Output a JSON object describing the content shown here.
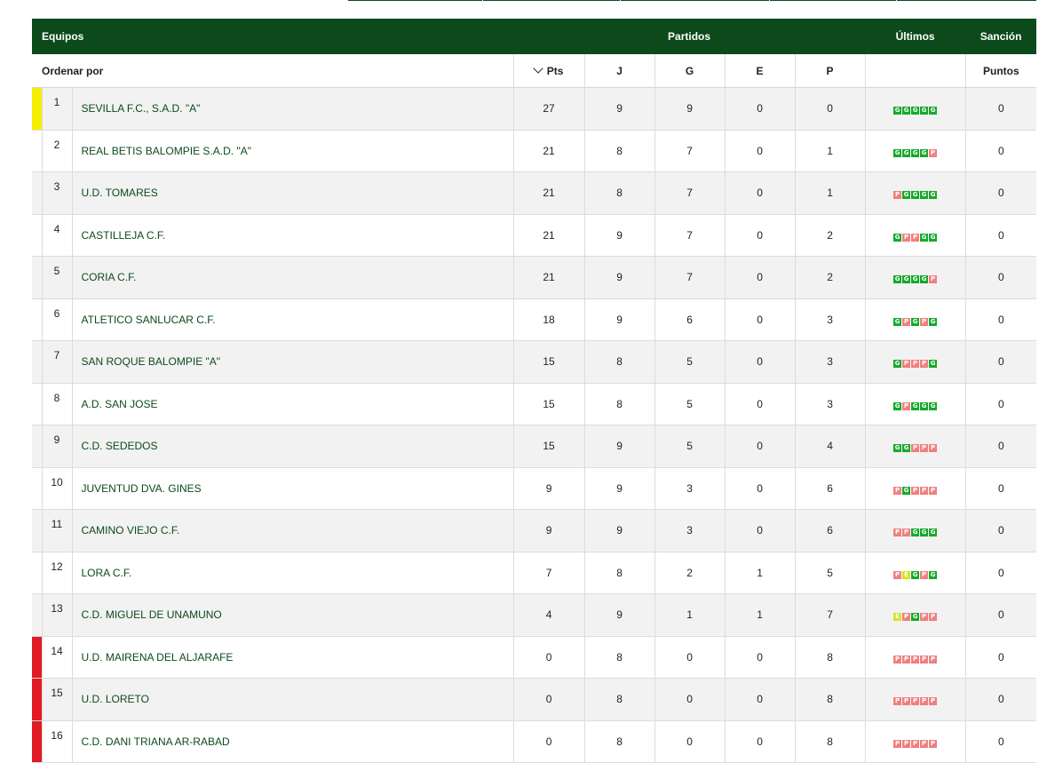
{
  "colors": {
    "header_bg": "#0c4a1c",
    "team_text": "#0c4a1c",
    "promotion": "#f4ee00",
    "relegation": "#e21a23",
    "win": "#16a92a",
    "loss": "#f08080",
    "draw": "#d7e21f"
  },
  "header": {
    "teams": "Equipos",
    "matches": "Partidos",
    "last": "Últimos",
    "sanction": "Sanción"
  },
  "subheader": {
    "sort_by": "Ordenar por",
    "pts": "Pts",
    "j": "J",
    "g": "G",
    "e": "E",
    "p": "P",
    "points": "Puntos"
  },
  "rows": [
    {
      "pos": "1",
      "team": "SEVILLA F.C., S.A.D. \"A\"",
      "pts": "27",
      "j": "9",
      "g": "9",
      "e": "0",
      "p": "0",
      "last": [
        "G",
        "G",
        "G",
        "G",
        "G"
      ],
      "sanction": "0",
      "zone": "promotion"
    },
    {
      "pos": "2",
      "team": "REAL BETIS BALOMPIE S.A.D. \"A\"",
      "pts": "21",
      "j": "8",
      "g": "7",
      "e": "0",
      "p": "1",
      "last": [
        "G",
        "G",
        "G",
        "G",
        "P"
      ],
      "sanction": "0",
      "zone": ""
    },
    {
      "pos": "3",
      "team": "U.D. TOMARES",
      "pts": "21",
      "j": "8",
      "g": "7",
      "e": "0",
      "p": "1",
      "last": [
        "P",
        "G",
        "G",
        "G",
        "G"
      ],
      "sanction": "0",
      "zone": ""
    },
    {
      "pos": "4",
      "team": "CASTILLEJA C.F.",
      "pts": "21",
      "j": "9",
      "g": "7",
      "e": "0",
      "p": "2",
      "last": [
        "G",
        "P",
        "P",
        "G",
        "G"
      ],
      "sanction": "0",
      "zone": ""
    },
    {
      "pos": "5",
      "team": "CORIA C.F.",
      "pts": "21",
      "j": "9",
      "g": "7",
      "e": "0",
      "p": "2",
      "last": [
        "G",
        "G",
        "G",
        "G",
        "P"
      ],
      "sanction": "0",
      "zone": ""
    },
    {
      "pos": "6",
      "team": "ATLETICO SANLUCAR C.F.",
      "pts": "18",
      "j": "9",
      "g": "6",
      "e": "0",
      "p": "3",
      "last": [
        "G",
        "P",
        "G",
        "P",
        "G"
      ],
      "sanction": "0",
      "zone": ""
    },
    {
      "pos": "7",
      "team": "SAN ROQUE BALOMPIE \"A\"",
      "pts": "15",
      "j": "8",
      "g": "5",
      "e": "0",
      "p": "3",
      "last": [
        "G",
        "P",
        "P",
        "P",
        "G"
      ],
      "sanction": "0",
      "zone": ""
    },
    {
      "pos": "8",
      "team": "A.D. SAN JOSE",
      "pts": "15",
      "j": "8",
      "g": "5",
      "e": "0",
      "p": "3",
      "last": [
        "G",
        "P",
        "G",
        "G",
        "G"
      ],
      "sanction": "0",
      "zone": ""
    },
    {
      "pos": "9",
      "team": "C.D. SEDEDOS",
      "pts": "15",
      "j": "9",
      "g": "5",
      "e": "0",
      "p": "4",
      "last": [
        "G",
        "G",
        "P",
        "P",
        "P"
      ],
      "sanction": "0",
      "zone": ""
    },
    {
      "pos": "10",
      "team": "JUVENTUD DVA. GINES",
      "pts": "9",
      "j": "9",
      "g": "3",
      "e": "0",
      "p": "6",
      "last": [
        "P",
        "G",
        "P",
        "P",
        "P"
      ],
      "sanction": "0",
      "zone": ""
    },
    {
      "pos": "11",
      "team": "CAMINO VIEJO C.F.",
      "pts": "9",
      "j": "9",
      "g": "3",
      "e": "0",
      "p": "6",
      "last": [
        "P",
        "P",
        "G",
        "G",
        "G"
      ],
      "sanction": "0",
      "zone": ""
    },
    {
      "pos": "12",
      "team": "LORA C.F.",
      "pts": "7",
      "j": "8",
      "g": "2",
      "e": "1",
      "p": "5",
      "last": [
        "P",
        "E",
        "G",
        "P",
        "G"
      ],
      "sanction": "0",
      "zone": ""
    },
    {
      "pos": "13",
      "team": "C.D. MIGUEL DE UNAMUNO",
      "pts": "4",
      "j": "9",
      "g": "1",
      "e": "1",
      "p": "7",
      "last": [
        "E",
        "P",
        "G",
        "P",
        "P"
      ],
      "sanction": "0",
      "zone": ""
    },
    {
      "pos": "14",
      "team": "U.D. MAIRENA DEL ALJARAFE",
      "pts": "0",
      "j": "8",
      "g": "0",
      "e": "0",
      "p": "8",
      "last": [
        "P",
        "P",
        "P",
        "P",
        "P"
      ],
      "sanction": "0",
      "zone": "relegation"
    },
    {
      "pos": "15",
      "team": "U.D. LORETO",
      "pts": "0",
      "j": "8",
      "g": "0",
      "e": "0",
      "p": "8",
      "last": [
        "P",
        "P",
        "P",
        "P",
        "P"
      ],
      "sanction": "0",
      "zone": "relegation"
    },
    {
      "pos": "16",
      "team": "C.D. DANI TRIANA AR-RABAD",
      "pts": "0",
      "j": "8",
      "g": "0",
      "e": "0",
      "p": "8",
      "last": [
        "P",
        "P",
        "P",
        "P",
        "P"
      ],
      "sanction": "0",
      "zone": "relegation"
    }
  ]
}
